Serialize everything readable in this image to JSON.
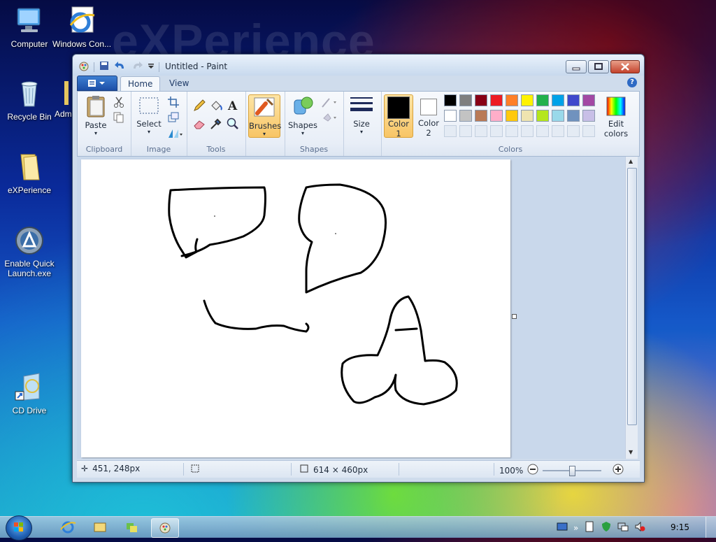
{
  "desktop": {
    "watermark": "eXPerience",
    "icons": [
      {
        "label": "Computer"
      },
      {
        "label": "Windows Con..."
      },
      {
        "label": "Recycle Bin"
      },
      {
        "label": "Adm"
      },
      {
        "label": "eXPerience"
      },
      {
        "label": "Enable Quick Launch.exe"
      },
      {
        "label": "CD Drive"
      }
    ]
  },
  "window": {
    "title": "Untitled - Paint",
    "tabs": [
      {
        "label": "Home"
      },
      {
        "label": "View"
      }
    ],
    "ribbon": {
      "clipboard": {
        "group": "Clipboard",
        "paste": "Paste"
      },
      "image": {
        "group": "Image",
        "select": "Select"
      },
      "tools": {
        "group": "Tools"
      },
      "brushes": {
        "label": "Brushes"
      },
      "shapes": {
        "group": "Shapes",
        "label": "Shapes"
      },
      "size": {
        "label": "Size"
      },
      "colors": {
        "group": "Colors",
        "color1_line1": "Color",
        "color1_line2": "1",
        "color2_line1": "Color",
        "color2_line2": "2",
        "edit_line1": "Edit",
        "edit_line2": "colors",
        "color1": "#000000",
        "color2": "#ffffff",
        "palette_row1": [
          "#000000",
          "#7f7f7f",
          "#880015",
          "#ed1c24",
          "#ff7f27",
          "#fff200",
          "#22b14c",
          "#00a2e8",
          "#3f48cc",
          "#a349a4"
        ],
        "palette_row2": [
          "#ffffff",
          "#c3c3c3",
          "#b97a57",
          "#ffaec9",
          "#ffc90e",
          "#efe4b0",
          "#b5e61d",
          "#99d9ea",
          "#7092be",
          "#c8bfe7"
        ]
      }
    },
    "status": {
      "cursor_pos": "451, 248px",
      "canvas_size": "614 × 460px",
      "zoom": "100%"
    }
  },
  "taskbar": {
    "clock": "9:15"
  }
}
